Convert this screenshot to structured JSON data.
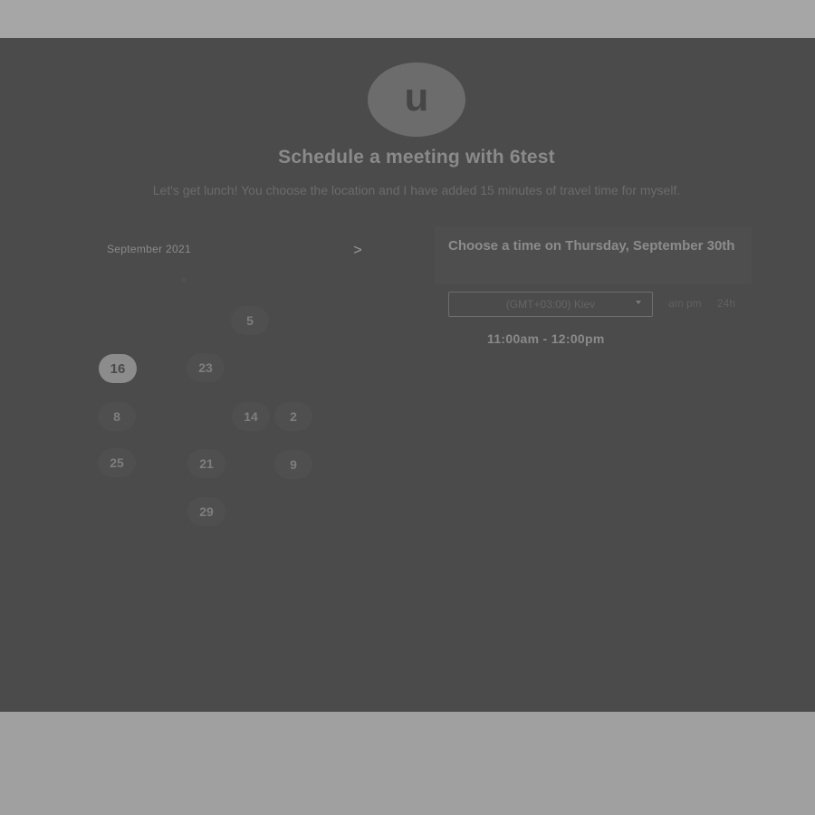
{
  "avatar": {
    "initial": "u"
  },
  "header": {
    "title": "Schedule a meeting with 6test",
    "description": "Let's get lunch! You choose the location and I have added 15 minutes of travel time for myself."
  },
  "calendar": {
    "month_label": "September 2021",
    "next_icon": "chevron-right-icon",
    "next_glyph": ">",
    "days": [
      {
        "label": "5"
      },
      {
        "label": "16",
        "selected": true
      },
      {
        "label": "23"
      },
      {
        "label": "8"
      },
      {
        "label": "14"
      },
      {
        "label": "2"
      },
      {
        "label": "25"
      },
      {
        "label": "21"
      },
      {
        "label": "9"
      },
      {
        "label": "29"
      }
    ]
  },
  "times": {
    "heading": "Choose a time on Thursday, September 30th",
    "timezone": "(GMT+03:00) Kiev",
    "format_ampm": "am pm",
    "format_24h": "24h",
    "slots": [
      "11:00am - 12:00pm"
    ]
  },
  "colors": {
    "panel": "#4b4b4b",
    "page_band": "#a3a3a3",
    "selected_day": "#8c8c8c"
  }
}
